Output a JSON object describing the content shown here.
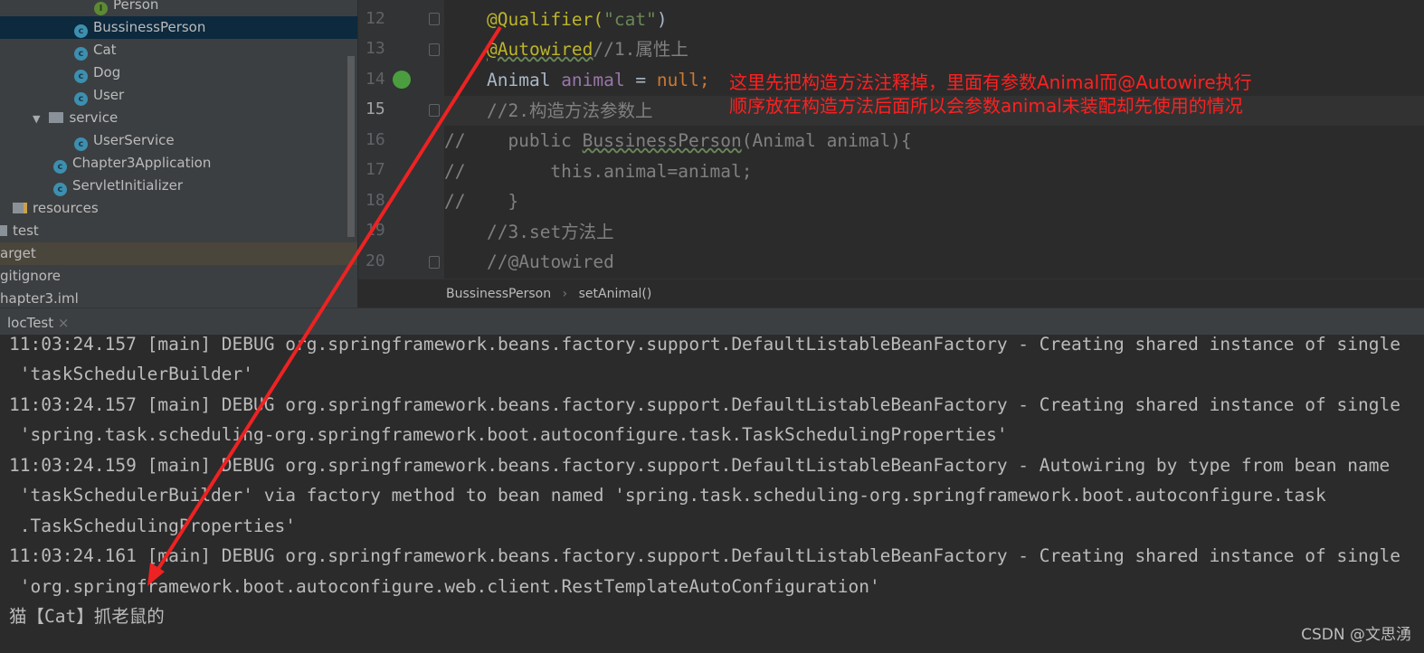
{
  "sidebar": {
    "items": [
      {
        "label": "Person",
        "icon": "interface-icon"
      },
      {
        "label": "BussinessPerson",
        "icon": "class-icon",
        "selected": true
      },
      {
        "label": "Cat",
        "icon": "class-icon"
      },
      {
        "label": "Dog",
        "icon": "class-icon"
      },
      {
        "label": "User",
        "icon": "class-icon"
      },
      {
        "label": "service",
        "icon": "package-folder-icon"
      },
      {
        "label": "UserService",
        "icon": "class-icon"
      },
      {
        "label": "Chapter3Application",
        "icon": "spring-boot-class-icon"
      },
      {
        "label": "ServletInitializer",
        "icon": "class-icon"
      },
      {
        "label": "resources",
        "icon": "resources-folder-icon"
      },
      {
        "label": "test",
        "icon": "folder-icon"
      },
      {
        "label": "arget",
        "icon": ""
      },
      {
        "label": "gitignore",
        "icon": ""
      },
      {
        "label": "hapter3.iml",
        "icon": ""
      }
    ]
  },
  "editor": {
    "line_numbers": [
      "12",
      "13",
      "14",
      "15",
      "16",
      "17",
      "18",
      "19",
      "20"
    ],
    "current_line": "15",
    "lines": {
      "l12a": "@Qualifier(",
      "l12b": "\"cat\"",
      "l12c": ")",
      "l13a": "@Autowired",
      "l13b": "//1.属性上",
      "l14a": "Animal ",
      "l14b": "animal",
      "l14c": " = ",
      "l14d": "null;",
      "l15": "//2.构造方法参数上",
      "l16a": "//    public ",
      "l16b": "BussinessPerson",
      "l16c": "(Animal animal){",
      "l17": "//        this.animal=animal;",
      "l18": "//    }",
      "l19": "//3.set方法上",
      "l20": "//@Autowired"
    },
    "annotation_note": [
      "这里先把构造方法注释掉，里面有参数Animal而@Autowire执行",
      "顺序放在构造方法后面所以会参数animal未装配却先使用的情况"
    ],
    "annotation_color": "#ff2020"
  },
  "breadcrumb": {
    "class": "BussinessPerson",
    "sep": "›",
    "method": "setAnimal()"
  },
  "run_tab": {
    "label": "locTest",
    "close": "×"
  },
  "console": {
    "lines": [
      "11:03:24.157 [main] DEBUG org.springframework.beans.factory.support.DefaultListableBeanFactory - Creating shared instance of single",
      " 'taskSchedulerBuilder'",
      "11:03:24.157 [main] DEBUG org.springframework.beans.factory.support.DefaultListableBeanFactory - Creating shared instance of single",
      " 'spring.task.scheduling-org.springframework.boot.autoconfigure.task.TaskSchedulingProperties'",
      "11:03:24.159 [main] DEBUG org.springframework.beans.factory.support.DefaultListableBeanFactory - Autowiring by type from bean name",
      " 'taskSchedulerBuilder' via factory method to bean named 'spring.task.scheduling-org.springframework.boot.autoconfigure.task",
      " .TaskSchedulingProperties'",
      "11:03:24.161 [main] DEBUG org.springframework.beans.factory.support.DefaultListableBeanFactory - Creating shared instance of single",
      " 'org.springframework.boot.autoconfigure.web.client.RestTemplateAutoConfiguration'",
      "猫【Cat】抓老鼠的"
    ]
  },
  "watermark": "CSDN @文思湧",
  "colors": {
    "arrow": "#ee2222",
    "sidebar_bg": "#3c3f41",
    "editor_bg": "#2b2b2b",
    "selection": "#0d293e"
  }
}
